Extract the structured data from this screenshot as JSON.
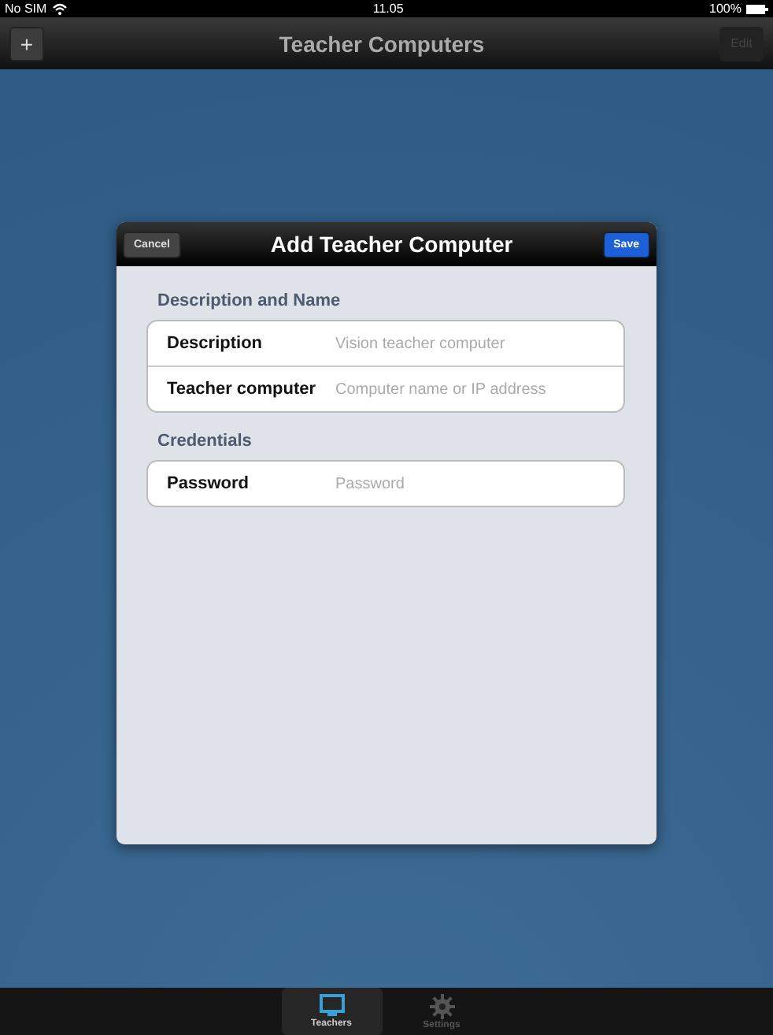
{
  "status_bar": {
    "carrier": "No SIM",
    "time": "11.05",
    "battery": "100%"
  },
  "nav_bar": {
    "title": "Teacher Computers",
    "add_button": "+",
    "edit_button": {
      "label": "Edit",
      "disabled": true
    }
  },
  "dialog": {
    "title": "Add Teacher Computer",
    "cancel": "Cancel",
    "save": "Save",
    "sections": [
      {
        "header": "Description and Name",
        "fields": [
          {
            "label": "Description",
            "placeholder": "Vision teacher computer"
          },
          {
            "label": "Teacher computer",
            "placeholder": "Computer name or IP address"
          }
        ]
      },
      {
        "header": "Credentials",
        "fields": [
          {
            "label": "Password",
            "placeholder": "Password"
          }
        ]
      }
    ]
  },
  "tab_bar": [
    {
      "label": "Teachers",
      "kind": "monitor",
      "selected": true
    },
    {
      "label": "Settings",
      "kind": "gear",
      "selected": false
    }
  ]
}
